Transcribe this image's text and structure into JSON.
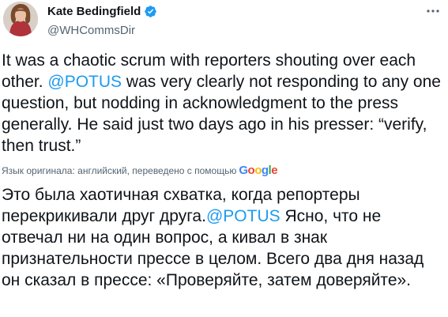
{
  "author": {
    "name": "Kate Bedingfield",
    "handle": "@WHCommsDir",
    "verified": true
  },
  "tweet": {
    "text_part1": "It was a chaotic scrum with reporters shouting over each other. ",
    "mention": "@POTUS",
    "text_part2": " was very clearly not responding to any one question, but nodding in acknowledgment to the press generally. He said just two days ago in his presser: “verify, then trust.”"
  },
  "translation": {
    "attribution": "Язык оригинала: английский, переведено с помощью",
    "provider": "Google",
    "text_part1": "Это была хаотичная схватка, когда репортеры перекрикивали друг друга.",
    "mention": "@POTUS",
    "text_part2": " Ясно, что не отвечал ни на один вопрос, а кивал в знак признательности прессе в целом. Всего два дня назад он сказал в прессе: «Проверяйте, затем доверяйте»."
  },
  "colors": {
    "link": "#1d9bf0",
    "secondary_text": "#536471",
    "google_blue": "#4285F4",
    "google_red": "#EA4335",
    "google_yellow": "#FBBC05",
    "google_green": "#34A853"
  },
  "icons": {
    "verified": "verified-badge-icon",
    "more": "more-options-icon"
  }
}
